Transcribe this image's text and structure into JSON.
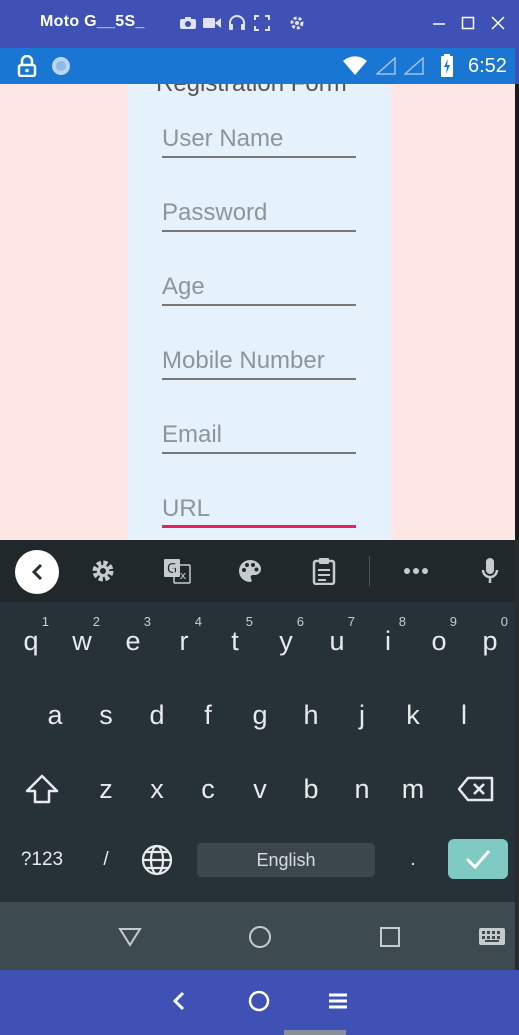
{
  "emulator": {
    "title": "Moto G__5S_",
    "toolbar_icons": [
      "camera-icon",
      "video-icon",
      "headphones-icon",
      "fullscreen-icon",
      "settings-icon"
    ],
    "window_buttons": [
      "minimize",
      "maximize",
      "close"
    ]
  },
  "status_bar": {
    "time": "6:52",
    "icons": [
      "lock-icon",
      "sync-icon",
      "wifi-icon",
      "signal-icon",
      "signal-icon",
      "battery-charging-icon"
    ]
  },
  "form": {
    "title": "Registration Form",
    "fields": [
      {
        "name": "username",
        "placeholder": "User Name",
        "value": ""
      },
      {
        "name": "password",
        "placeholder": "Password",
        "value": ""
      },
      {
        "name": "age",
        "placeholder": "Age",
        "value": ""
      },
      {
        "name": "mobile",
        "placeholder": "Mobile Number",
        "value": ""
      },
      {
        "name": "email",
        "placeholder": "Email",
        "value": ""
      },
      {
        "name": "url",
        "placeholder": "URL",
        "value": "",
        "focused": true
      }
    ]
  },
  "keyboard": {
    "toolbar": [
      "back",
      "settings",
      "translate",
      "theme",
      "clipboard",
      "more",
      "microphone"
    ],
    "row1": [
      {
        "key": "q",
        "hint": "1"
      },
      {
        "key": "w",
        "hint": "2"
      },
      {
        "key": "e",
        "hint": "3"
      },
      {
        "key": "r",
        "hint": "4"
      },
      {
        "key": "t",
        "hint": "5"
      },
      {
        "key": "y",
        "hint": "6"
      },
      {
        "key": "u",
        "hint": "7"
      },
      {
        "key": "i",
        "hint": "8"
      },
      {
        "key": "o",
        "hint": "9"
      },
      {
        "key": "p",
        "hint": "0"
      }
    ],
    "row2": [
      "a",
      "s",
      "d",
      "f",
      "g",
      "h",
      "j",
      "k",
      "l"
    ],
    "row3": [
      "z",
      "x",
      "c",
      "v",
      "b",
      "n",
      "m"
    ],
    "symbols_label": "?123",
    "slash": "/",
    "space_label": "English",
    "period": "."
  },
  "colors": {
    "emulator_bar": "#3f51b5",
    "status_bar": "#1976d2",
    "app_background": "#fde6e4",
    "form_background": "#e5f2fc",
    "focus_underline": "#e91e63",
    "keyboard_background": "#263238",
    "enter_key": "#7fcbc4"
  }
}
